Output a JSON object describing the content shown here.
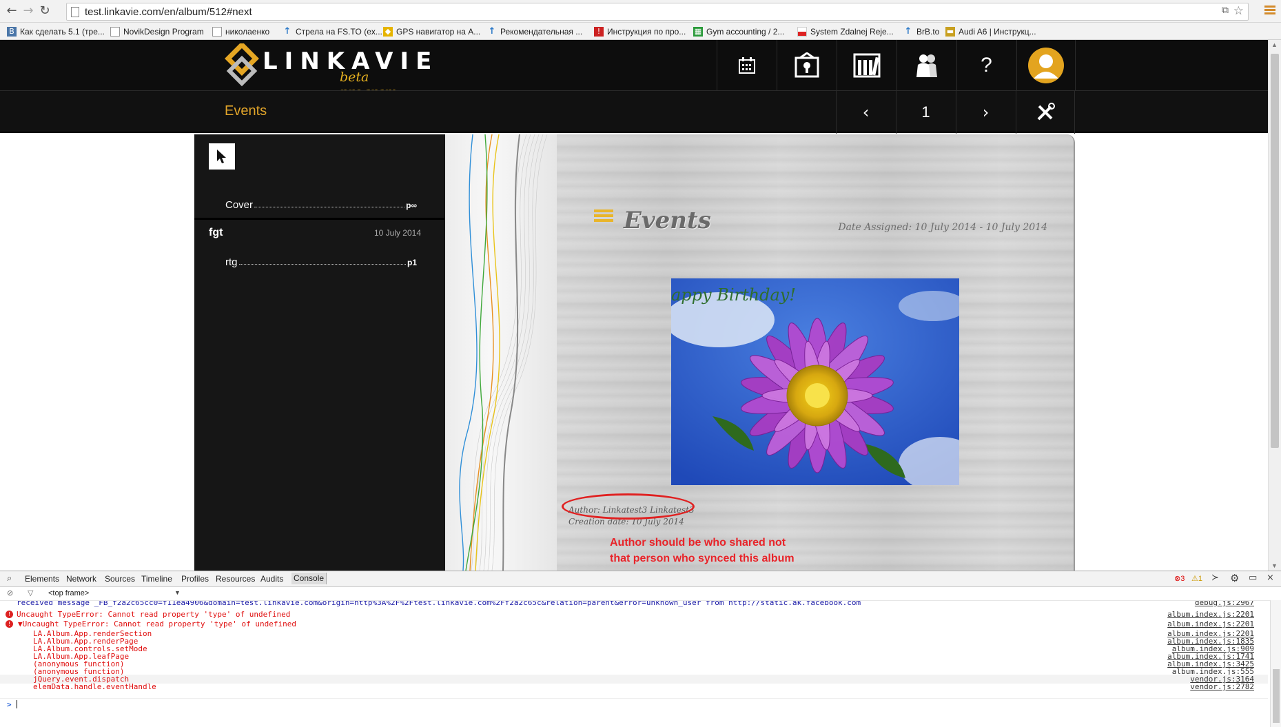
{
  "browser": {
    "url": "test.linkavie.com/en/album/512#next",
    "bookmarks": [
      {
        "label": "Как сделать 5.1 (тре...",
        "icon": "vk-icon",
        "color": "#4a76a8"
      },
      {
        "label": "NovikDesign Program",
        "icon": "page-icon",
        "color": "#999"
      },
      {
        "label": "николаенко",
        "icon": "page-icon",
        "color": "#999"
      },
      {
        "label": "Стрела на FS.TO (ex...",
        "icon": "arrow-up-icon",
        "color": "#2a78c8"
      },
      {
        "label": "GPS навигатор на А...",
        "icon": "gps-icon",
        "color": "#e6b400"
      },
      {
        "label": "Рекомендательная ...",
        "icon": "arrow-up-icon",
        "color": "#2a78c8"
      },
      {
        "label": "Инструкция по про...",
        "icon": "mark-icon",
        "color": "#cc2222"
      },
      {
        "label": "Gym accounting / 2...",
        "icon": "sheet-icon",
        "color": "#2a9a3a"
      },
      {
        "label": "System Zdalnej Reje...",
        "icon": "poland-flag-icon",
        "color": "#dd2222"
      },
      {
        "label": "BrB.to",
        "icon": "arrow-up-icon",
        "color": "#2a78c8"
      },
      {
        "label": "Audi A6 | Инструкц...",
        "icon": "car-icon",
        "color": "#c8a020"
      }
    ]
  },
  "site": {
    "logo_text": "LINKAVIE",
    "logo_sub": "beta program",
    "section_title": "Events",
    "page_number": "1"
  },
  "toc": {
    "cover_label": "Cover",
    "cover_page": "p∞",
    "group_label": "fgt",
    "group_date": "10 July 2014",
    "item_label": "rtg",
    "item_page": "p1"
  },
  "album_page": {
    "title": "Events",
    "date_assigned": "Date Assigned: 10 July 2014 - 10 July 2014",
    "photo_caption": "appy Birthday!",
    "author": "Author: Linkatest3 Linkatest3",
    "creation_date": "Creation date: 10 July 2014",
    "annotation_line1": "Author should be who shared not",
    "annotation_line2": "that person who synced this album"
  },
  "devtools": {
    "tabs": [
      "Elements",
      "Network",
      "Sources",
      "Timeline",
      "Profiles",
      "Resources",
      "Audits",
      "Console"
    ],
    "active_tab": "Console",
    "error_count": "3",
    "warning_count": "1",
    "frame": "<top frame>",
    "lines": [
      {
        "text": "received message _FB_f2a2c65cc0=f11ea4906&domain=test.linkavie.com&origin=http%3A%2F%2Ftest.linkavie.com%2Ff2a2c65c&relation=parent&error=unknown_user from http://static.ak.facebook.com",
        "src": "debug.js:2967",
        "kind": "info"
      },
      {
        "text": "Uncaught TypeError: Cannot read property 'type' of undefined",
        "src": "album.index.js:2201",
        "kind": "error"
      },
      {
        "text": "▼Uncaught TypeError: Cannot read property 'type' of undefined",
        "src": "album.index.js:2201",
        "kind": "error"
      },
      {
        "text": "LA.Album.App.renderSection",
        "src": "album.index.js:2201",
        "kind": "trace"
      },
      {
        "text": "LA.Album.App.renderPage",
        "src": "album.index.js:1835",
        "kind": "trace"
      },
      {
        "text": "LA.Album.controls.setMode",
        "src": "album.index.js:909",
        "kind": "trace"
      },
      {
        "text": "LA.Album.App.leafPage",
        "src": "album.index.js:1741",
        "kind": "trace"
      },
      {
        "text": "(anonymous function)",
        "src": "album.index.js:3425",
        "kind": "trace"
      },
      {
        "text": "(anonymous function)",
        "src": "album.index.js:555",
        "kind": "trace"
      },
      {
        "text": "jQuery.event.dispatch",
        "src": "vendor.js:3164",
        "kind": "trace"
      },
      {
        "text": "elemData.handle.eventHandle",
        "src": "vendor.js:2782",
        "kind": "trace"
      }
    ],
    "prompt": ">"
  },
  "colors": {
    "accent": "#e2a52a",
    "error": "#e8242a",
    "header_bg": "#0d0d0d"
  }
}
